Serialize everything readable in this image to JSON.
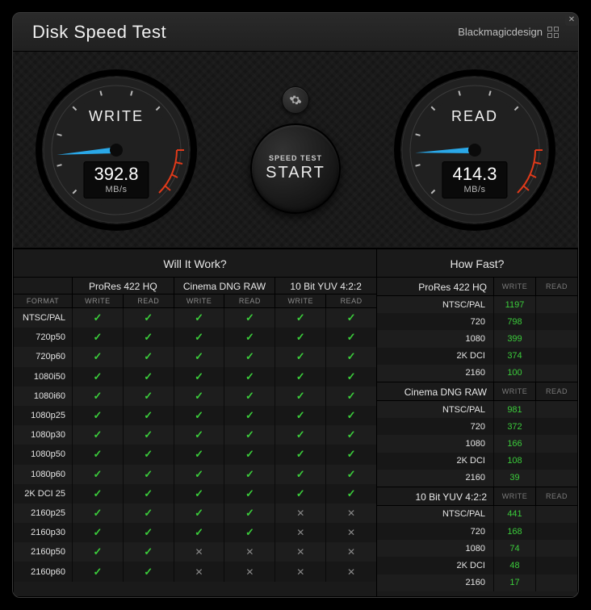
{
  "header": {
    "title": "Disk Speed Test",
    "brand": "Blackmagicdesign"
  },
  "gauges": {
    "write": {
      "label": "WRITE",
      "value": "392.8",
      "unit": "MB/s"
    },
    "read": {
      "label": "READ",
      "value": "414.3",
      "unit": "MB/s"
    }
  },
  "start": {
    "line1": "SPEED TEST",
    "line2": "START"
  },
  "icons": {
    "gear": "gear"
  },
  "wiw": {
    "title": "Will It Work?",
    "format_label": "FORMAT",
    "codecs": [
      "ProRes 422 HQ",
      "Cinema DNG RAW",
      "10 Bit YUV 4:2:2"
    ],
    "sub": [
      "WRITE",
      "READ",
      "WRITE",
      "READ",
      "WRITE",
      "READ"
    ],
    "rows": [
      {
        "fmt": "NTSC/PAL",
        "cells": [
          "y",
          "y",
          "y",
          "y",
          "y",
          "y"
        ]
      },
      {
        "fmt": "720p50",
        "cells": [
          "y",
          "y",
          "y",
          "y",
          "y",
          "y"
        ]
      },
      {
        "fmt": "720p60",
        "cells": [
          "y",
          "y",
          "y",
          "y",
          "y",
          "y"
        ]
      },
      {
        "fmt": "1080i50",
        "cells": [
          "y",
          "y",
          "y",
          "y",
          "y",
          "y"
        ]
      },
      {
        "fmt": "1080i60",
        "cells": [
          "y",
          "y",
          "y",
          "y",
          "y",
          "y"
        ]
      },
      {
        "fmt": "1080p25",
        "cells": [
          "y",
          "y",
          "y",
          "y",
          "y",
          "y"
        ]
      },
      {
        "fmt": "1080p30",
        "cells": [
          "y",
          "y",
          "y",
          "y",
          "y",
          "y"
        ]
      },
      {
        "fmt": "1080p50",
        "cells": [
          "y",
          "y",
          "y",
          "y",
          "y",
          "y"
        ]
      },
      {
        "fmt": "1080p60",
        "cells": [
          "y",
          "y",
          "y",
          "y",
          "y",
          "y"
        ]
      },
      {
        "fmt": "2K DCI 25",
        "cells": [
          "y",
          "y",
          "y",
          "y",
          "y",
          "y"
        ]
      },
      {
        "fmt": "2160p25",
        "cells": [
          "y",
          "y",
          "y",
          "y",
          "n",
          "n"
        ]
      },
      {
        "fmt": "2160p30",
        "cells": [
          "y",
          "y",
          "y",
          "y",
          "n",
          "n"
        ]
      },
      {
        "fmt": "2160p50",
        "cells": [
          "y",
          "y",
          "n",
          "n",
          "n",
          "n"
        ]
      },
      {
        "fmt": "2160p60",
        "cells": [
          "y",
          "y",
          "n",
          "n",
          "n",
          "n"
        ]
      }
    ]
  },
  "hf": {
    "title": "How Fast?",
    "write_label": "WRITE",
    "read_label": "READ",
    "groups": [
      {
        "codec": "ProRes 422 HQ",
        "rows": [
          {
            "res": "NTSC/PAL",
            "write": "1197",
            "read": ""
          },
          {
            "res": "720",
            "write": "798",
            "read": ""
          },
          {
            "res": "1080",
            "write": "399",
            "read": ""
          },
          {
            "res": "2K DCI",
            "write": "374",
            "read": ""
          },
          {
            "res": "2160",
            "write": "100",
            "read": ""
          }
        ]
      },
      {
        "codec": "Cinema DNG RAW",
        "rows": [
          {
            "res": "NTSC/PAL",
            "write": "981",
            "read": ""
          },
          {
            "res": "720",
            "write": "372",
            "read": ""
          },
          {
            "res": "1080",
            "write": "166",
            "read": ""
          },
          {
            "res": "2K DCI",
            "write": "108",
            "read": ""
          },
          {
            "res": "2160",
            "write": "39",
            "read": ""
          }
        ]
      },
      {
        "codec": "10 Bit YUV 4:2:2",
        "rows": [
          {
            "res": "NTSC/PAL",
            "write": "441",
            "read": ""
          },
          {
            "res": "720",
            "write": "168",
            "read": ""
          },
          {
            "res": "1080",
            "write": "74",
            "read": ""
          },
          {
            "res": "2K DCI",
            "write": "48",
            "read": ""
          },
          {
            "res": "2160",
            "write": "17",
            "read": ""
          }
        ]
      }
    ]
  }
}
